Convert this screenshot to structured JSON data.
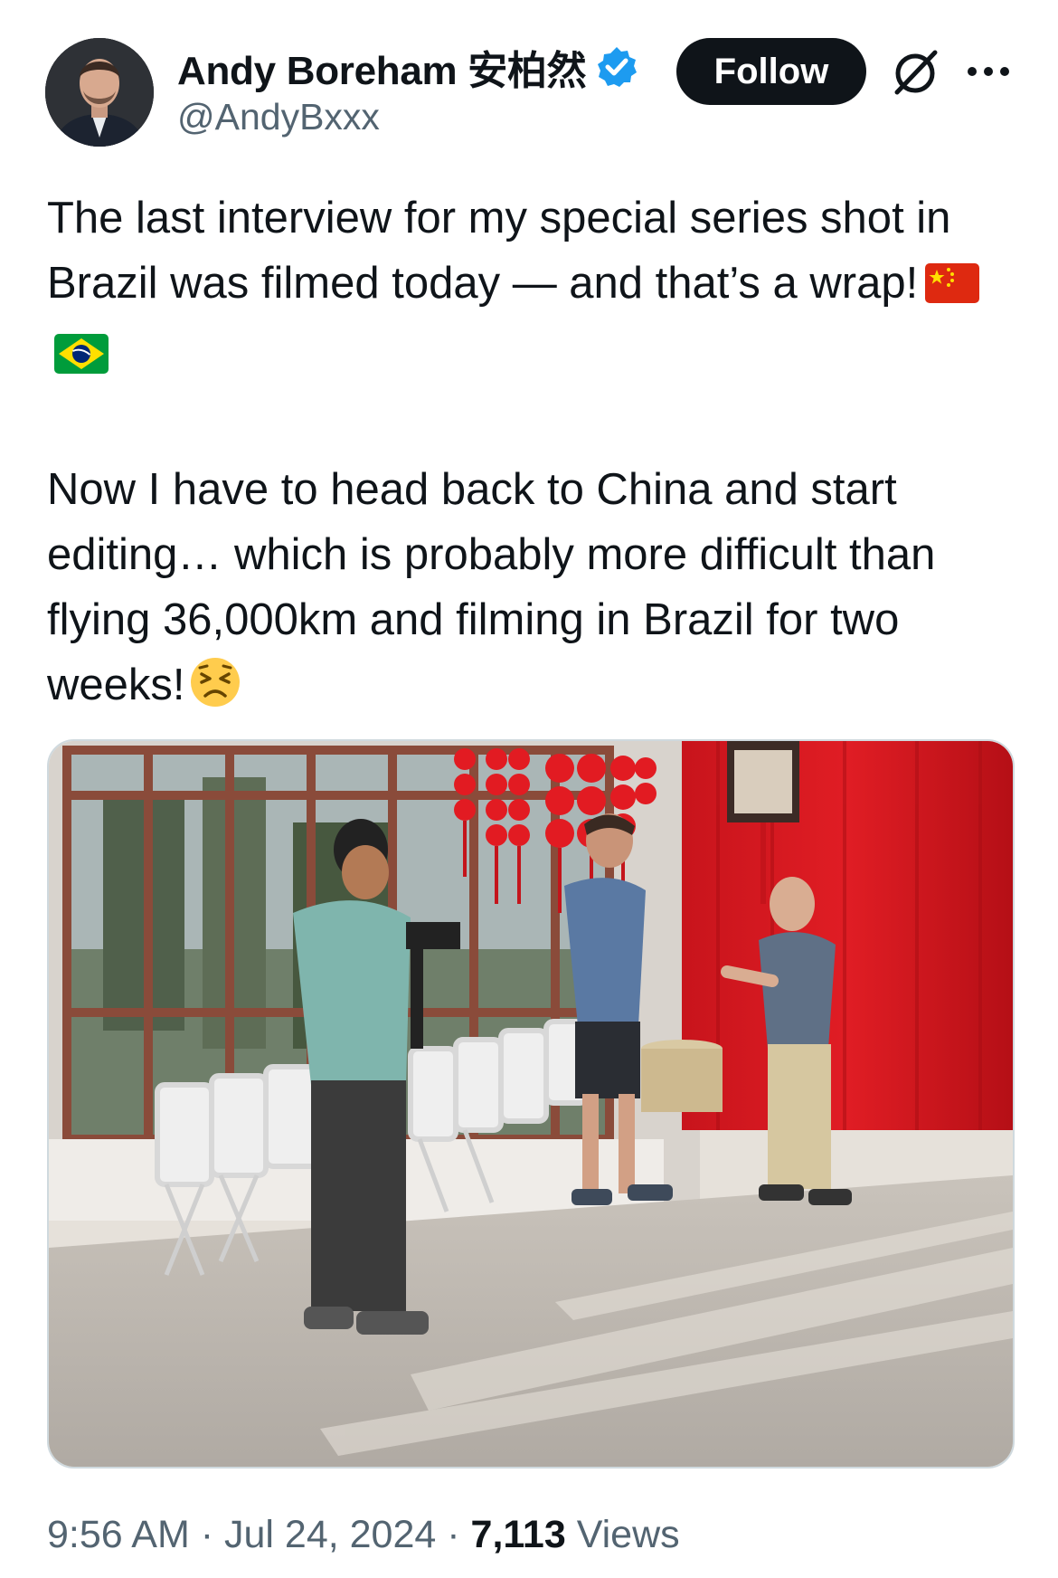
{
  "author": {
    "display_name": "Andy Boreham 安柏然",
    "handle": "@AndyBxxx",
    "verified": true,
    "avatar_icon": "profile-photo"
  },
  "actions": {
    "follow_label": "Follow",
    "grok_icon": "grok-icon",
    "more_icon": "more-options-icon"
  },
  "tweet": {
    "paragraph1": "The last interview for my special series shot in Brazil was filmed today — and that’s a wrap!",
    "paragraph1_emojis": [
      "china-flag",
      "brazil-flag"
    ],
    "paragraph2": "Now I have to head back to China and start editing… which is probably more difficult than flying 36,000km and filming in Brazil for two weeks!",
    "paragraph2_emoji": "persevering-face"
  },
  "media": {
    "kind": "photo"
  },
  "meta": {
    "time": "9:56 AM",
    "separator": "·",
    "date": "Jul 24, 2024",
    "views_count": "7,113",
    "views_label": "Views"
  },
  "colors": {
    "text_primary": "#0f1419",
    "text_secondary": "#536471",
    "verified_blue": "#1d9bf0",
    "follow_bg": "#0f1419"
  }
}
